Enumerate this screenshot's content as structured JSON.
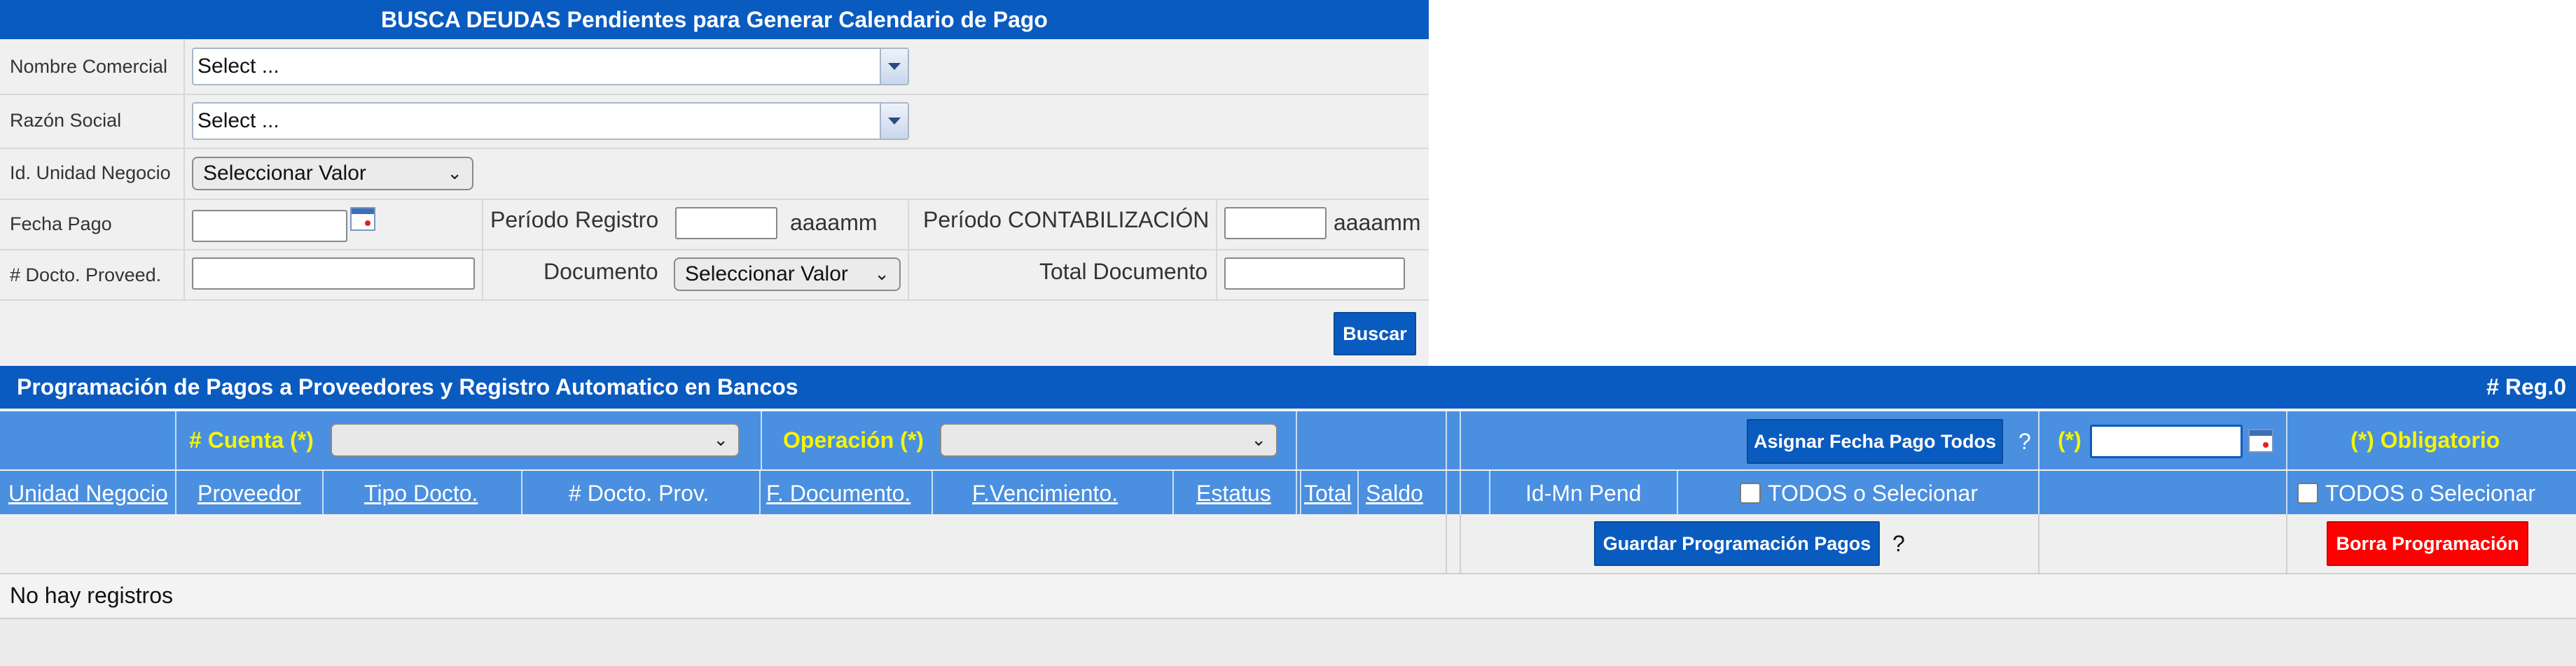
{
  "search": {
    "title": "BUSCA DEUDAS Pendientes para Generar Calendario de Pago",
    "nombre_comercial_label": "Nombre Comercial",
    "nombre_comercial_value": "Select ...",
    "razon_social_label": "Razón Social",
    "razon_social_value": "Select ...",
    "unidad_negocio_label": "Id. Unidad Negocio",
    "unidad_negocio_value": "Seleccionar Valor",
    "fecha_pago_label": "Fecha Pago",
    "periodo_registro_label": "Período Registro",
    "periodo_registro_hint": "aaaamm",
    "periodo_contab_label": "Período CONTABILIZACIÓN",
    "periodo_contab_hint": "aaaamm",
    "docto_proveed_label": "# Docto. Proveed.",
    "documento_label": "Documento",
    "documento_value": "Seleccionar Valor",
    "total_documento_label": "Total Documento",
    "buscar_label": "Buscar"
  },
  "prog": {
    "title": "Programación de Pagos a Proveedores y Registro Automatico en Bancos",
    "reg_count": "# Reg.0",
    "cuenta_label": "# Cuenta (*)",
    "operacion_label": "Operación (*)",
    "asignar_label": "Asignar Fecha Pago Todos",
    "help_1": "?",
    "required_mark": "(*)",
    "obligatorio_label": "(*) Obligatorio",
    "columns": {
      "unidad_negocio": "Unidad Negocio",
      "proveedor": "Proveedor",
      "tipo_docto": "Tipo Docto.",
      "docto_prov": "# Docto. Prov.",
      "f_documento": "F. Documento.",
      "f_vencimiento": "F.Vencimiento.",
      "estatus": "Estatus",
      "total": "Total",
      "saldo": "Saldo",
      "id_mn_pend": "Id-Mn Pend",
      "todos_1": "TODOS o Selecionar",
      "todos_2": "TODOS o Selecionar"
    },
    "guardar_label": "Guardar Programación Pagos",
    "help_2": "?",
    "borra_label": "Borra Programación",
    "empty_message": "No hay registros"
  },
  "colors": {
    "header_blue": "#0a5bbf",
    "light_blue": "#4a8fe0",
    "required_yellow": "#f5f500",
    "delete_red": "#ff0000"
  }
}
